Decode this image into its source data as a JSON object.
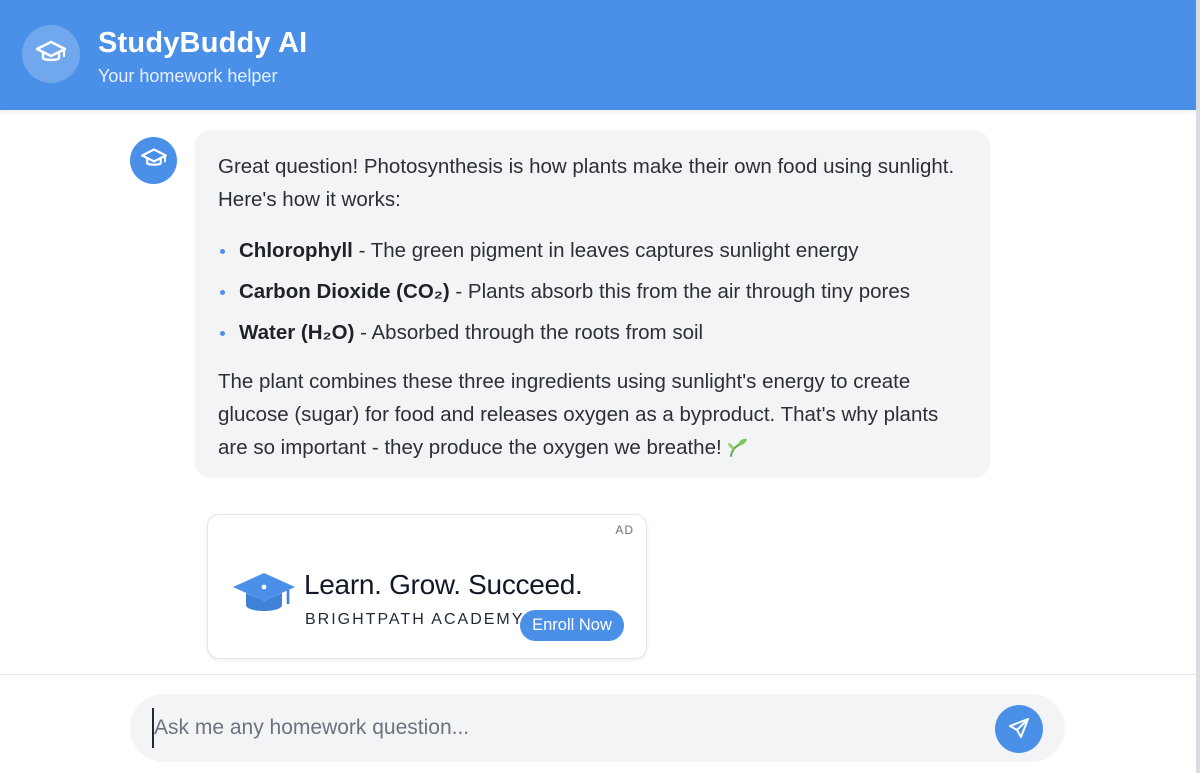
{
  "header": {
    "title": "StudyBuddy AI",
    "subtitle": "Your homework helper",
    "logo_icon": "graduation-cap-icon"
  },
  "message": {
    "avatar_icon": "graduation-cap-icon",
    "intro": "Great question! Photosynthesis is how plants make their own food using sunlight. Here's how it works:",
    "items": [
      {
        "term": "Chlorophyll",
        "desc": " - The green pigment in leaves captures sunlight energy"
      },
      {
        "term": "Carbon Dioxide (CO₂)",
        "desc": " - Plants absorb this from the air through tiny pores"
      },
      {
        "term": "Water (H₂O)",
        "desc": " - Absorbed through the roots from soil"
      }
    ],
    "conclusion": "The plant combines these three ingredients using sunlight's energy to create glucose (sugar) for food and releases oxygen as a byproduct. That's why plants are so important - they produce the oxygen we breathe!",
    "emoji_icon": "seedling-icon"
  },
  "ad": {
    "label": "AD",
    "headline": "Learn. Grow. Succeed.",
    "brand": "BRIGHTPATH ACADEMY",
    "cta": "Enroll Now",
    "icon": "graduation-cap-icon"
  },
  "composer": {
    "placeholder": "Ask me any homework question...",
    "value": "",
    "send_icon": "send-icon"
  },
  "colors": {
    "accent": "#4a90e8",
    "bubble_bg": "#f3f4f6",
    "text": "#2b2f36"
  }
}
